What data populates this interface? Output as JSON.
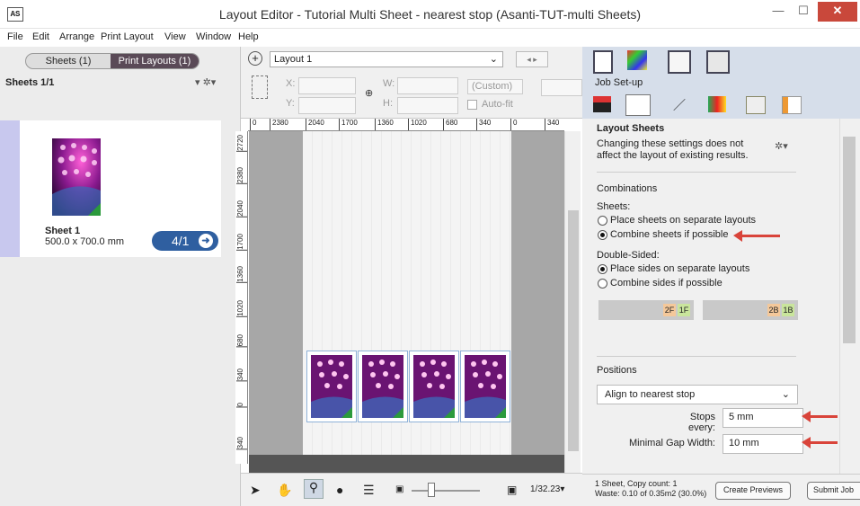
{
  "window": {
    "app_icon": "AS",
    "title": "Layout Editor - Tutorial Multi Sheet - nearest stop (Asanti-TUT-multi Sheets)",
    "minimize": "—",
    "maximize": "☐",
    "close": "✕"
  },
  "menu": [
    "File",
    "Edit",
    "Arrange",
    "Print Layout",
    "View",
    "Window",
    "Help"
  ],
  "left": {
    "tab_sheets": "Sheets (1)",
    "tab_print_layouts": "Print Layouts (1)",
    "sheets_count": "Sheets 1/1",
    "tools": "▾ ✲▾",
    "sheet": {
      "name": "Sheet 1",
      "size": "500.0 x 700.0 mm",
      "badge": "4/1",
      "badge_icon": "➜"
    }
  },
  "toolbar": {
    "add_icon": "+",
    "layout_name": "Layout 1",
    "caret": "⌄",
    "nav": "◂ ▸",
    "x_label": "X:",
    "y_label": "Y:",
    "w_label": "W:",
    "h_label": "H:",
    "link_icon": "⊕",
    "preset": "(Custom)",
    "autofit": "Auto-fit"
  },
  "ruler": {
    "top": [
      "0",
      "2380",
      "2040",
      "1700",
      "1360",
      "1020",
      "680",
      "340",
      "0",
      "340"
    ],
    "left": [
      "2720",
      "2380",
      "2040",
      "1700",
      "1360",
      "1020",
      "680",
      "340",
      "0",
      "340"
    ]
  },
  "bottom_toolbar": {
    "zoom": "1/32.23▾"
  },
  "right": {
    "job_setup": "Job Set-up",
    "section_title": "Layout Sheets",
    "note": "Changing these settings does not affect the layout of existing results.",
    "combinations": "Combinations",
    "sheets_label": "Sheets:",
    "sheets_opt1": "Place sheets on separate layouts",
    "sheets_opt2": "Combine sheets if possible",
    "double_sided_label": "Double-Sided:",
    "ds_opt1": "Place sides on separate layouts",
    "ds_opt2": "Combine sides if possible",
    "tags": [
      "2F",
      "1F",
      "2B",
      "1B"
    ],
    "positions": "Positions",
    "align_value": "Align to nearest stop",
    "stops_label": "Stops every:",
    "stops_value": "5 mm",
    "gap_label": "Minimal Gap Width:",
    "gap_value": "10 mm",
    "status_line1": "1 Sheet, Copy count: 1",
    "status_line2": "Waste: 0.10 of 0.35m2 (30.0%)",
    "create_previews": "Create Previews",
    "submit_job": "Submit Job"
  },
  "colors": {
    "accent_red": "#d9443a",
    "badge_blue": "#2f5fa0",
    "segment_selected": "#5a4a57"
  }
}
